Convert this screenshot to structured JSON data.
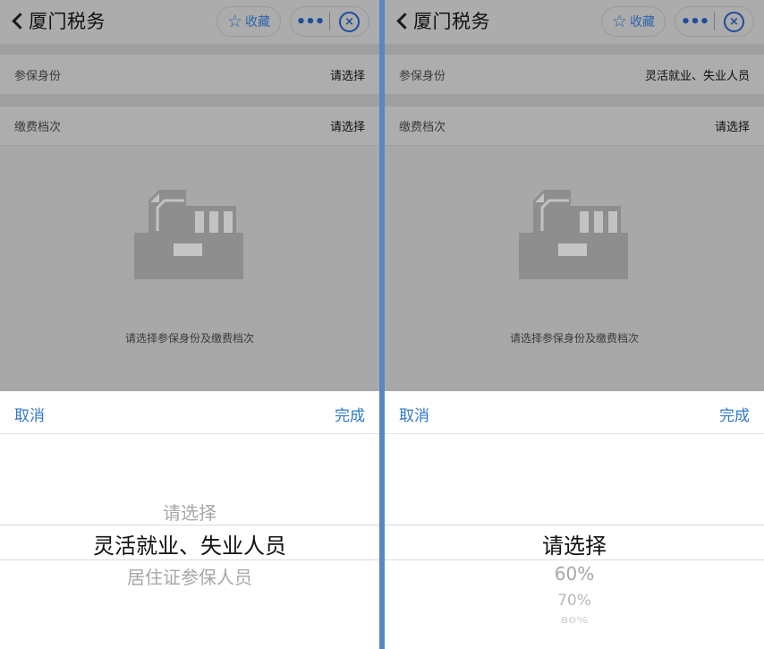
{
  "left": {
    "header": {
      "title": "厦门税务",
      "favorite_label": "收藏"
    },
    "rows": [
      {
        "label": "参保身份",
        "value": "请选择"
      },
      {
        "label": "缴费档次",
        "value": "请选择"
      }
    ],
    "empty_text": "请选择参保身份及缴费档次",
    "picker": {
      "cancel": "取消",
      "done": "完成",
      "options_above": [
        "请选择"
      ],
      "selected": "灵活就业、失业人员",
      "options_below": [
        "居住证参保人员"
      ]
    }
  },
  "right": {
    "header": {
      "title": "厦门税务",
      "favorite_label": "收藏"
    },
    "rows": [
      {
        "label": "参保身份",
        "value": "灵活就业、失业人员"
      },
      {
        "label": "缴费档次",
        "value": "请选择"
      }
    ],
    "empty_text": "请选择参保身份及缴费档次",
    "picker": {
      "cancel": "取消",
      "done": "完成",
      "options_above": [],
      "selected": "请选择",
      "options_below": [
        "60%",
        "70%",
        "80%"
      ]
    }
  },
  "icons": {
    "back": "chevron-left-icon",
    "favorite": "star-icon",
    "more": "more-icon",
    "close": "close-circle-icon",
    "empty": "empty-box-icon"
  },
  "colors": {
    "accent": "#3178c6",
    "divider": "#5a86c3",
    "overlay_gray": "#a8a8a8"
  }
}
